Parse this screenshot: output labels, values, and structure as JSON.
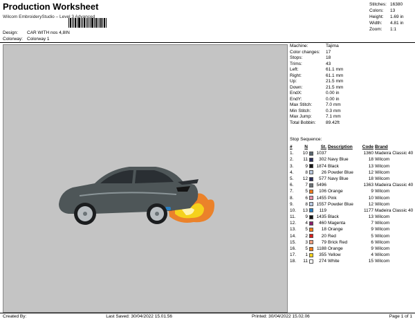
{
  "header": {
    "title": "Production Worksheet",
    "software": "Wilcom EmbroideryStudio – Level 3 Advanced",
    "design_label": "Design:",
    "design_value": "CAR WITH nos 4,8IN",
    "colorway_label": "Colorway:",
    "colorway_value": "Colorway 1"
  },
  "summary": [
    {
      "k": "Stitches:",
      "v": "16380"
    },
    {
      "k": "Colors:",
      "v": "13"
    },
    {
      "k": "Height:",
      "v": "1.69 in"
    },
    {
      "k": "Width:",
      "v": "4.81 in"
    },
    {
      "k": "Zoom:",
      "v": "1:1"
    }
  ],
  "info": [
    {
      "k": "Machine:",
      "v": "Tajima"
    },
    {
      "k": "Color changes:",
      "v": "17"
    },
    {
      "k": "Stops:",
      "v": "18"
    },
    {
      "k": "Trims:",
      "v": "43"
    },
    {
      "k": "Left:",
      "v": "61.1 mm"
    },
    {
      "k": "Right:",
      "v": "61.1 mm"
    },
    {
      "k": "Up:",
      "v": "21.5 mm"
    },
    {
      "k": "Down:",
      "v": "21.5 mm"
    },
    {
      "k": "EndX:",
      "v": "0.00 in"
    },
    {
      "k": "EndY:",
      "v": "0.00 in"
    },
    {
      "k": "Max Stitch:",
      "v": "7.0 mm"
    },
    {
      "k": "Min Stitch:",
      "v": "0.3 mm"
    },
    {
      "k": "Max Jump:",
      "v": "7.1 mm"
    },
    {
      "k": "Total Bobbin:",
      "v": "89.42ft"
    }
  ],
  "stop_sequence": {
    "label": "Stop Sequence:",
    "headers": {
      "stop": "#",
      "n": "N",
      "st": "St.",
      "desc": "Description",
      "code": "Code",
      "brand": "Brand"
    },
    "rows": [
      {
        "stop": "1.",
        "n": "10",
        "st": "1037",
        "desc": "",
        "code": "1360",
        "brand": "Madeira Classic 40",
        "color": "#5a6670"
      },
      {
        "stop": "2.",
        "n": "11",
        "st": "302",
        "desc": "Navy Blue",
        "code": "18",
        "brand": "Wilcom",
        "color": "#2b2f5c"
      },
      {
        "stop": "3.",
        "n": "9",
        "st": "1874",
        "desc": "Black",
        "code": "13",
        "brand": "Wilcom",
        "color": "#151515"
      },
      {
        "stop": "4.",
        "n": "8",
        "st": "26",
        "desc": "Powder Blue",
        "code": "12",
        "brand": "Wilcom",
        "color": "#b9c9e0"
      },
      {
        "stop": "5.",
        "n": "12",
        "st": "577",
        "desc": "Navy Blue",
        "code": "18",
        "brand": "Wilcom",
        "color": "#2b2f5c"
      },
      {
        "stop": "6.",
        "n": "7",
        "st": "5496",
        "desc": "",
        "code": "1363",
        "brand": "Madeira Classic 40",
        "color": "#6c7478"
      },
      {
        "stop": "7.",
        "n": "5",
        "st": "106",
        "desc": "Orange",
        "code": "9",
        "brand": "Wilcom",
        "color": "#f07b1a"
      },
      {
        "stop": "8.",
        "n": "6",
        "st": "1455",
        "desc": "Pink",
        "code": "10",
        "brand": "Wilcom",
        "color": "#e890a8"
      },
      {
        "stop": "9.",
        "n": "8",
        "st": "1557",
        "desc": "Powder Blue",
        "code": "12",
        "brand": "Wilcom",
        "color": "#b9c9e0"
      },
      {
        "stop": "10.",
        "n": "13",
        "st": "119",
        "desc": "",
        "code": "1177",
        "brand": "Madeira Classic 40",
        "color": "#2a7fc0"
      },
      {
        "stop": "11.",
        "n": "9",
        "st": "1435",
        "desc": "Black",
        "code": "13",
        "brand": "Wilcom",
        "color": "#151515"
      },
      {
        "stop": "12.",
        "n": "4",
        "st": "460",
        "desc": "Magenta",
        "code": "7",
        "brand": "Wilcom",
        "color": "#8a1f6a"
      },
      {
        "stop": "13.",
        "n": "5",
        "st": "18",
        "desc": "Orange",
        "code": "9",
        "brand": "Wilcom",
        "color": "#f07b1a"
      },
      {
        "stop": "14.",
        "n": "2",
        "st": "20",
        "desc": "Red",
        "code": "5",
        "brand": "Wilcom",
        "color": "#d8201e"
      },
      {
        "stop": "15.",
        "n": "3",
        "st": "79",
        "desc": "Brick Red",
        "code": "6",
        "brand": "Wilcom",
        "color": "#f0a080"
      },
      {
        "stop": "16.",
        "n": "5",
        "st": "1188",
        "desc": "Orange",
        "code": "9",
        "brand": "Wilcom",
        "color": "#f07b1a"
      },
      {
        "stop": "17.",
        "n": "1",
        "st": "355",
        "desc": "Yellow",
        "code": "4",
        "brand": "Wilcom",
        "color": "#f5d21c"
      },
      {
        "stop": "18.",
        "n": "11",
        "st": "274",
        "desc": "White",
        "code": "15",
        "brand": "Wilcom",
        "color": "#ffffff"
      }
    ]
  },
  "footer": {
    "created_by": "Created By:",
    "last_saved": "Last Saved: 30/04/2022 15.01.56",
    "printed": "Printed: 30/04/2022 15.02.06",
    "page": "Page 1 of 1"
  },
  "colors": {
    "design_bg": "#c4c4c4",
    "car_body": "#4e5658"
  }
}
